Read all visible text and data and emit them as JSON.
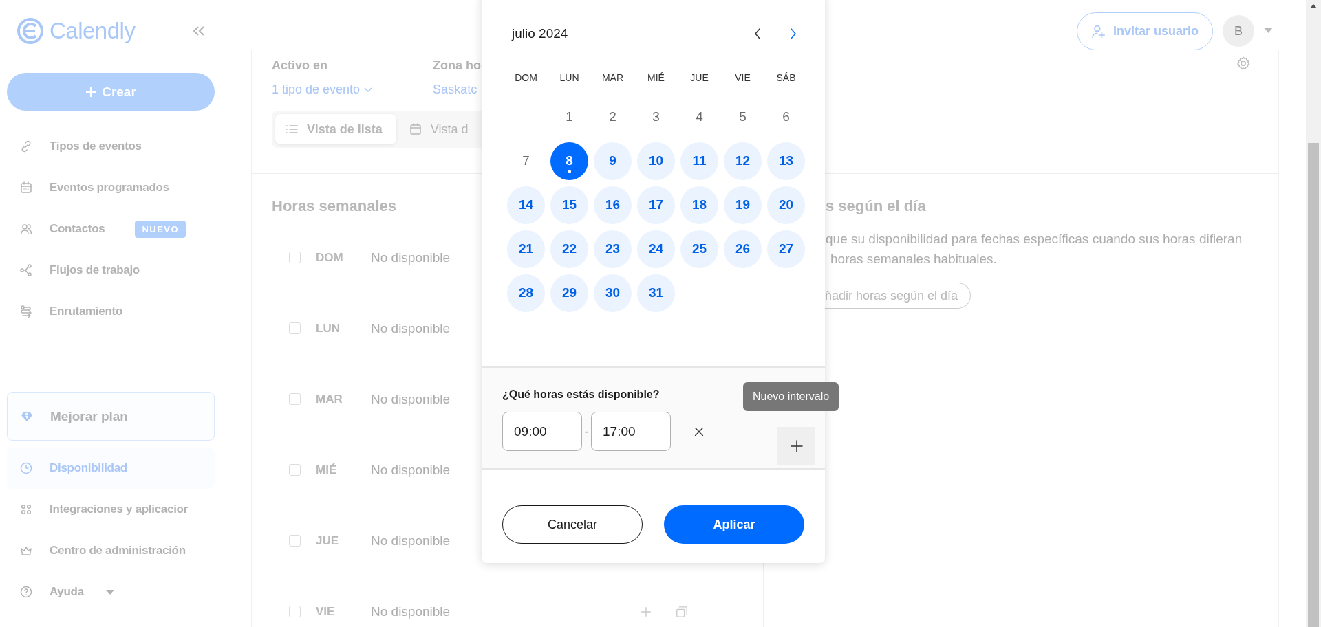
{
  "sidebar": {
    "logo": "Calendly",
    "create_button": "Crear",
    "items": [
      {
        "label": "Tipos de eventos",
        "selected": false
      },
      {
        "label": "Eventos programados",
        "selected": false
      },
      {
        "label": "Contactos",
        "badge": "NUEVO",
        "selected": false
      },
      {
        "label": "Flujos de trabajo",
        "selected": false
      },
      {
        "label": "Enrutamiento",
        "selected": false
      }
    ],
    "upgrade": "Mejorar plan",
    "bottom_items": [
      {
        "label": "Disponibilidad",
        "selected": true
      },
      {
        "label": "Integraciones y aplicacior",
        "selected": false
      },
      {
        "label": "Centro de administración",
        "selected": false
      },
      {
        "label": "Ayuda",
        "selected": false,
        "dropdown": true
      }
    ]
  },
  "header": {
    "invite_button": "Invitar usuario",
    "avatar": "B"
  },
  "schedule": {
    "active_label": "Activo en",
    "active_value": "1 tipo de evento",
    "timezone_label": "Zona ho",
    "timezone_value": "Saskatc",
    "views": [
      {
        "label": "Vista de lista",
        "selected": true
      },
      {
        "label": "Vista d",
        "selected": false
      }
    ],
    "weekly_title": "Horas semanales",
    "week": [
      {
        "day": "DOM",
        "checked": false,
        "status": "No disponible"
      },
      {
        "day": "LUN",
        "checked": false,
        "status": "No disponible"
      },
      {
        "day": "MAR",
        "checked": false,
        "status": "No disponible"
      },
      {
        "day": "MIÉ",
        "checked": false,
        "status": "No disponible"
      },
      {
        "day": "JUE",
        "checked": false,
        "status": "No disponible"
      },
      {
        "day": "VIE",
        "checked": false,
        "status": "No disponible",
        "actions": true
      }
    ],
    "overrides_title": "s según el día",
    "overrides_text": [
      "que su disponibilidad para fechas específicas cuando sus horas difieran",
      "horas semanales habituales."
    ],
    "overrides_button": "ñadir horas según el día"
  },
  "date_picker": {
    "month": "julio 2024",
    "weekdays": [
      "DOM",
      "LUN",
      "MAR",
      "MIÉ",
      "JUE",
      "VIE",
      "SÁB"
    ],
    "days": [
      {
        "kind": "blank"
      },
      {
        "kind": "past",
        "label": "1"
      },
      {
        "kind": "past",
        "label": "2"
      },
      {
        "kind": "past",
        "label": "3"
      },
      {
        "kind": "past",
        "label": "4"
      },
      {
        "kind": "past",
        "label": "5"
      },
      {
        "kind": "past",
        "label": "6"
      },
      {
        "kind": "past",
        "label": "7"
      },
      {
        "kind": "available",
        "label": "8",
        "selected": true,
        "today": true
      },
      {
        "kind": "available",
        "label": "9",
        "selected": false,
        "today": false
      },
      {
        "kind": "available",
        "label": "10",
        "selected": false,
        "today": false
      },
      {
        "kind": "available",
        "label": "11",
        "selected": false,
        "today": false
      },
      {
        "kind": "available",
        "label": "12",
        "selected": false,
        "today": false
      },
      {
        "kind": "available",
        "label": "13",
        "selected": false,
        "today": false
      },
      {
        "kind": "available",
        "label": "14",
        "selected": false,
        "today": false
      },
      {
        "kind": "available",
        "label": "15",
        "selected": false,
        "today": false
      },
      {
        "kind": "available",
        "label": "16",
        "selected": false,
        "today": false
      },
      {
        "kind": "available",
        "label": "17",
        "selected": false,
        "today": false
      },
      {
        "kind": "available",
        "label": "18",
        "selected": false,
        "today": false
      },
      {
        "kind": "available",
        "label": "19",
        "selected": false,
        "today": false
      },
      {
        "kind": "available",
        "label": "20",
        "selected": false,
        "today": false
      },
      {
        "kind": "available",
        "label": "21",
        "selected": false,
        "today": false
      },
      {
        "kind": "available",
        "label": "22",
        "selected": false,
        "today": false
      },
      {
        "kind": "available",
        "label": "23",
        "selected": false,
        "today": false
      },
      {
        "kind": "available",
        "label": "24",
        "selected": false,
        "today": false
      },
      {
        "kind": "available",
        "label": "25",
        "selected": false,
        "today": false
      },
      {
        "kind": "available",
        "label": "26",
        "selected": false,
        "today": false
      },
      {
        "kind": "available",
        "label": "27",
        "selected": false,
        "today": false
      },
      {
        "kind": "available",
        "label": "28",
        "selected": false,
        "today": false
      },
      {
        "kind": "available",
        "label": "29",
        "selected": false,
        "today": false
      },
      {
        "kind": "available",
        "label": "30",
        "selected": false,
        "today": false
      },
      {
        "kind": "available",
        "label": "31",
        "selected": false,
        "today": false
      }
    ],
    "hours_question": "¿Qué horas estás disponible?",
    "interval": {
      "start": "09:00",
      "separator": "-",
      "end": "17:00"
    },
    "tooltip": "Nuevo intervalo",
    "cancel_button": "Cancelar",
    "apply_button": "Aplicar"
  }
}
